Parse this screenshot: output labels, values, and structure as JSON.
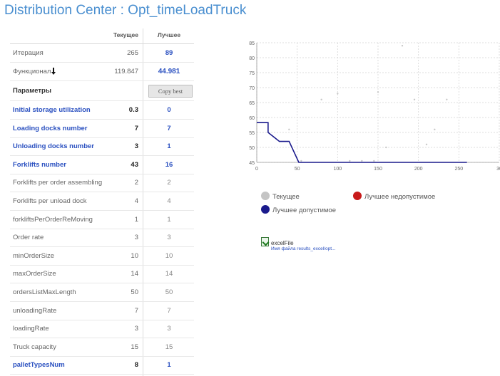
{
  "title": "Distribution Center : Opt_timeLoadTruck",
  "table": {
    "col_current": "Текущее",
    "col_best": "Лучшее",
    "iteration": {
      "label": "Итерация",
      "current": "265",
      "best": "89"
    },
    "functional": {
      "label": "Функционал",
      "current": "119.847",
      "best": "44.981"
    },
    "params_label": "Параметры",
    "copy_best_label": "Copy best",
    "params": [
      {
        "name": "Initial storage utilization",
        "current": "0.3",
        "best": "0",
        "highlight": true
      },
      {
        "name": "Loading docks number",
        "current": "7",
        "best": "7",
        "highlight": true
      },
      {
        "name": "Unloading docks number",
        "current": "3",
        "best": "1",
        "highlight": true
      },
      {
        "name": "Forklifts number",
        "current": "43",
        "best": "16",
        "highlight": true
      },
      {
        "name": "Forklifts per order assembling",
        "current": "2",
        "best": "2",
        "highlight": false
      },
      {
        "name": "Forklifts per unload dock",
        "current": "4",
        "best": "4",
        "highlight": false
      },
      {
        "name": "forkliftsPerOrderReMoving",
        "current": "1",
        "best": "1",
        "highlight": false
      },
      {
        "name": "Order rate",
        "current": "3",
        "best": "3",
        "highlight": false
      },
      {
        "name": "minOrderSize",
        "current": "10",
        "best": "10",
        "highlight": false
      },
      {
        "name": "maxOrderSize",
        "current": "14",
        "best": "14",
        "highlight": false
      },
      {
        "name": "ordersListMaxLength",
        "current": "50",
        "best": "50",
        "highlight": false
      },
      {
        "name": "unloadingRate",
        "current": "7",
        "best": "7",
        "highlight": false
      },
      {
        "name": "loadingRate",
        "current": "3",
        "best": "3",
        "highlight": false
      },
      {
        "name": "Truck capacity",
        "current": "15",
        "best": "15",
        "highlight": false
      },
      {
        "name": "palletTypesNum",
        "current": "8",
        "best": "1",
        "highlight": true
      }
    ]
  },
  "chart_data": {
    "type": "line",
    "xlim": [
      0,
      300
    ],
    "ylim": [
      45,
      85
    ],
    "x_ticks": [
      "0",
      "50",
      "100",
      "150",
      "200",
      "250",
      "30"
    ],
    "y_ticks": [
      "45",
      "50",
      "55",
      "60",
      "65",
      "70",
      "75",
      "80",
      "85"
    ],
    "grid": true,
    "series": [
      {
        "name": "Лучшее допустимое",
        "color": "#1a1a8c",
        "x": [
          0,
          14,
          14,
          28,
          40,
          52,
          80,
          120,
          180,
          220,
          260
        ],
        "y": [
          58.3,
          58.3,
          55,
          52,
          52,
          45,
          45,
          45,
          45,
          45,
          45
        ]
      },
      {
        "name": "Текущее",
        "color": "#c8c8c8",
        "x": [
          40,
          55,
          80,
          100,
          115,
          130,
          145,
          150,
          160,
          180,
          195,
          210,
          220,
          235
        ],
        "y": [
          56,
          45.5,
          66,
          68,
          45.5,
          45.5,
          45.5,
          68.5,
          50,
          84,
          66,
          51,
          56,
          66
        ]
      }
    ],
    "legend": [
      {
        "label": "Текущее",
        "color": "#c4c4c4"
      },
      {
        "label": "Лучшее недопустимое",
        "color": "#c81a1a"
      },
      {
        "label": "Лучшее допустимое",
        "color": "#1a1a8c"
      }
    ]
  },
  "excel": {
    "name": "excelFile",
    "path": "Имя файла results_excel/opt..."
  },
  "icons": {
    "sort": "sort-down-icon",
    "excel": "excel-file-icon"
  }
}
